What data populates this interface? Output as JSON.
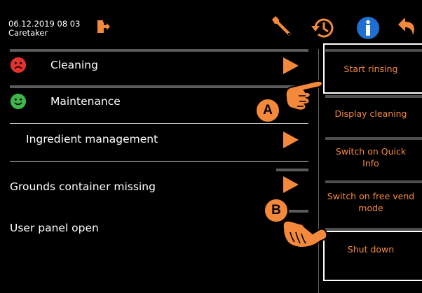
{
  "header": {
    "datetime": "06.12.2019 08 03",
    "role": "Caretaker",
    "icons": [
      "logout-icon",
      "wrench-icon",
      "history-icon",
      "info-icon",
      "back-icon"
    ]
  },
  "left_panel": {
    "cleaning": {
      "label": "Cleaning",
      "status": "sad",
      "status_color": "#e3332f"
    },
    "maintenance": {
      "label": "Maintenance",
      "status": "happy",
      "status_color": "#3fb64a"
    },
    "ingredient": {
      "label": "Ingredient management"
    },
    "grounds": {
      "label": "Grounds container missing"
    },
    "user_panel": {
      "label": "User panel open"
    }
  },
  "right_panel": {
    "start_rinsing": "Start rinsing",
    "display_cleaning": "Display cleaning",
    "quick_info_line1": "Switch on Quick",
    "quick_info_line2": "Info",
    "free_vend_line1": "Switch on free vend",
    "free_vend_line2": "mode",
    "shut_down": "Shut down"
  },
  "callouts": {
    "a": "A",
    "b": "B"
  },
  "colors": {
    "accent": "#f4893b",
    "background": "#000000"
  }
}
